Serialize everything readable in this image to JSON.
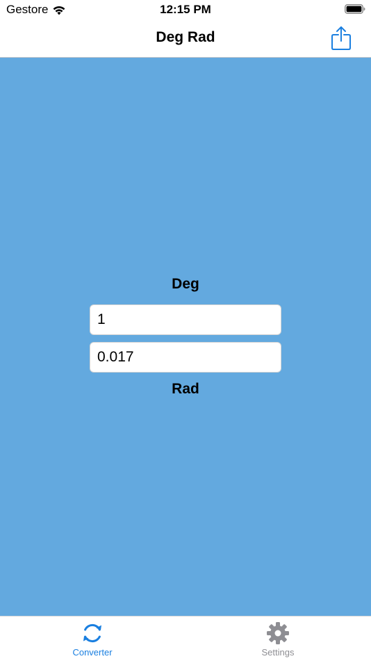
{
  "status_bar": {
    "carrier": "Gestore",
    "time": "12:15 PM"
  },
  "nav": {
    "title": "Deg Rad",
    "share_icon": "share-icon"
  },
  "converter": {
    "top_label": "Deg",
    "deg_value": "1",
    "rad_value": "0.017",
    "bottom_label": "Rad"
  },
  "tabs": [
    {
      "label": "Converter",
      "icon": "refresh-icon",
      "selected": true
    },
    {
      "label": "Settings",
      "icon": "gear-icon",
      "selected": false
    }
  ],
  "colors": {
    "content_background": "#63a9df",
    "accent": "#1a7fe0",
    "inactive": "#8e8e93"
  }
}
